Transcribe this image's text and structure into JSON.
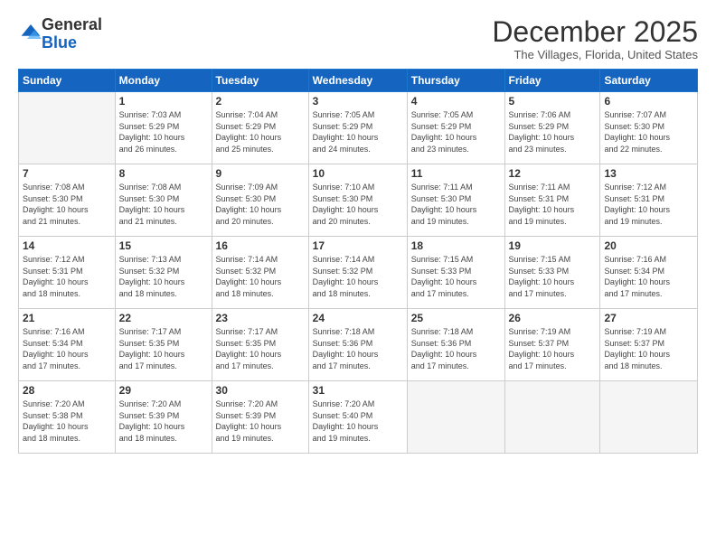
{
  "logo": {
    "general": "General",
    "blue": "Blue"
  },
  "title": "December 2025",
  "location": "The Villages, Florida, United States",
  "days_header": [
    "Sunday",
    "Monday",
    "Tuesday",
    "Wednesday",
    "Thursday",
    "Friday",
    "Saturday"
  ],
  "weeks": [
    [
      {
        "day": "",
        "info": ""
      },
      {
        "day": "1",
        "info": "Sunrise: 7:03 AM\nSunset: 5:29 PM\nDaylight: 10 hours\nand 26 minutes."
      },
      {
        "day": "2",
        "info": "Sunrise: 7:04 AM\nSunset: 5:29 PM\nDaylight: 10 hours\nand 25 minutes."
      },
      {
        "day": "3",
        "info": "Sunrise: 7:05 AM\nSunset: 5:29 PM\nDaylight: 10 hours\nand 24 minutes."
      },
      {
        "day": "4",
        "info": "Sunrise: 7:05 AM\nSunset: 5:29 PM\nDaylight: 10 hours\nand 23 minutes."
      },
      {
        "day": "5",
        "info": "Sunrise: 7:06 AM\nSunset: 5:29 PM\nDaylight: 10 hours\nand 23 minutes."
      },
      {
        "day": "6",
        "info": "Sunrise: 7:07 AM\nSunset: 5:30 PM\nDaylight: 10 hours\nand 22 minutes."
      }
    ],
    [
      {
        "day": "7",
        "info": "Sunrise: 7:08 AM\nSunset: 5:30 PM\nDaylight: 10 hours\nand 21 minutes."
      },
      {
        "day": "8",
        "info": "Sunrise: 7:08 AM\nSunset: 5:30 PM\nDaylight: 10 hours\nand 21 minutes."
      },
      {
        "day": "9",
        "info": "Sunrise: 7:09 AM\nSunset: 5:30 PM\nDaylight: 10 hours\nand 20 minutes."
      },
      {
        "day": "10",
        "info": "Sunrise: 7:10 AM\nSunset: 5:30 PM\nDaylight: 10 hours\nand 20 minutes."
      },
      {
        "day": "11",
        "info": "Sunrise: 7:11 AM\nSunset: 5:30 PM\nDaylight: 10 hours\nand 19 minutes."
      },
      {
        "day": "12",
        "info": "Sunrise: 7:11 AM\nSunset: 5:31 PM\nDaylight: 10 hours\nand 19 minutes."
      },
      {
        "day": "13",
        "info": "Sunrise: 7:12 AM\nSunset: 5:31 PM\nDaylight: 10 hours\nand 19 minutes."
      }
    ],
    [
      {
        "day": "14",
        "info": "Sunrise: 7:12 AM\nSunset: 5:31 PM\nDaylight: 10 hours\nand 18 minutes."
      },
      {
        "day": "15",
        "info": "Sunrise: 7:13 AM\nSunset: 5:32 PM\nDaylight: 10 hours\nand 18 minutes."
      },
      {
        "day": "16",
        "info": "Sunrise: 7:14 AM\nSunset: 5:32 PM\nDaylight: 10 hours\nand 18 minutes."
      },
      {
        "day": "17",
        "info": "Sunrise: 7:14 AM\nSunset: 5:32 PM\nDaylight: 10 hours\nand 18 minutes."
      },
      {
        "day": "18",
        "info": "Sunrise: 7:15 AM\nSunset: 5:33 PM\nDaylight: 10 hours\nand 17 minutes."
      },
      {
        "day": "19",
        "info": "Sunrise: 7:15 AM\nSunset: 5:33 PM\nDaylight: 10 hours\nand 17 minutes."
      },
      {
        "day": "20",
        "info": "Sunrise: 7:16 AM\nSunset: 5:34 PM\nDaylight: 10 hours\nand 17 minutes."
      }
    ],
    [
      {
        "day": "21",
        "info": "Sunrise: 7:16 AM\nSunset: 5:34 PM\nDaylight: 10 hours\nand 17 minutes."
      },
      {
        "day": "22",
        "info": "Sunrise: 7:17 AM\nSunset: 5:35 PM\nDaylight: 10 hours\nand 17 minutes."
      },
      {
        "day": "23",
        "info": "Sunrise: 7:17 AM\nSunset: 5:35 PM\nDaylight: 10 hours\nand 17 minutes."
      },
      {
        "day": "24",
        "info": "Sunrise: 7:18 AM\nSunset: 5:36 PM\nDaylight: 10 hours\nand 17 minutes."
      },
      {
        "day": "25",
        "info": "Sunrise: 7:18 AM\nSunset: 5:36 PM\nDaylight: 10 hours\nand 17 minutes."
      },
      {
        "day": "26",
        "info": "Sunrise: 7:19 AM\nSunset: 5:37 PM\nDaylight: 10 hours\nand 17 minutes."
      },
      {
        "day": "27",
        "info": "Sunrise: 7:19 AM\nSunset: 5:37 PM\nDaylight: 10 hours\nand 18 minutes."
      }
    ],
    [
      {
        "day": "28",
        "info": "Sunrise: 7:20 AM\nSunset: 5:38 PM\nDaylight: 10 hours\nand 18 minutes."
      },
      {
        "day": "29",
        "info": "Sunrise: 7:20 AM\nSunset: 5:39 PM\nDaylight: 10 hours\nand 18 minutes."
      },
      {
        "day": "30",
        "info": "Sunrise: 7:20 AM\nSunset: 5:39 PM\nDaylight: 10 hours\nand 19 minutes."
      },
      {
        "day": "31",
        "info": "Sunrise: 7:20 AM\nSunset: 5:40 PM\nDaylight: 10 hours\nand 19 minutes."
      },
      {
        "day": "",
        "info": ""
      },
      {
        "day": "",
        "info": ""
      },
      {
        "day": "",
        "info": ""
      }
    ]
  ]
}
